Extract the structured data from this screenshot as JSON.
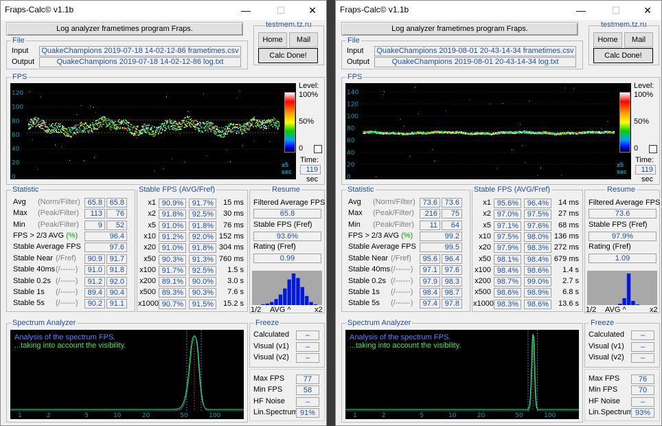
{
  "windows": [
    {
      "title": "Fraps-Calc© v1.1b",
      "header_text": "Log analyzer frametimes program Fraps.",
      "site_link": "testmem.tz.ru",
      "home_label": "Home",
      "mail_label": "Mail",
      "calc_label": "Calc Done!",
      "file_group": "File",
      "input_label": "Input",
      "output_label": "Output",
      "input_value": "QuakeChampions 2019-07-18 14-02-12-86 frametimes.csv",
      "output_value": "QuakeChampions 2019-07-18 14-02-12-86 log.txt",
      "fps_group": "FPS",
      "fps_ticks": [
        "120",
        "100",
        "80",
        "60",
        "40",
        "20",
        "0"
      ],
      "level_label": "Level:",
      "level_ticks": [
        "100%",
        "50%",
        "0"
      ],
      "time_label": "Time:",
      "time_value": "119",
      "time_unit": "sec",
      "x5_label": "x5",
      "sec_label": "sec",
      "statistic_group": "Statistic",
      "stable_group": "Stable FPS (AVG/Fref)",
      "resume_group": "Resume",
      "stats": [
        {
          "label": "Avg",
          "hint": "(Norm/Filter)",
          "v1": "65.8",
          "v2": "65.8"
        },
        {
          "label": "Max",
          "hint": "(Peak/Filter)",
          "v1": "113",
          "v2": "76"
        },
        {
          "label": "Min",
          "hint": "(Peak/Filter)",
          "v1": "9",
          "v2": "52"
        }
      ],
      "fps_23_label": "FPS > 2/3 AVG",
      "fps_23_pct": "(%)",
      "fps_23_value": "96.4",
      "stable_avg_label": "Stable Average FPS",
      "stable_avg_value": "97.6",
      "stable_rows": [
        {
          "label": "Stable Near",
          "hint": "(/Fref)",
          "v1": "90.9",
          "v2": "91.7"
        },
        {
          "label": "Stable 40ms",
          "hint": "(/------)",
          "v1": "91.0",
          "v2": "91.8"
        },
        {
          "label": "Stable 0.2s",
          "hint": "(/------)",
          "v1": "91.2",
          "v2": "92.0"
        },
        {
          "label": "Stable 1s",
          "hint": "(/------)",
          "v1": "89.4",
          "v2": "90.4"
        },
        {
          "label": "Stable 5s",
          "hint": "(/------)",
          "v1": "90.2",
          "v2": "91.1"
        }
      ],
      "stable_fps": [
        {
          "mult": "x1",
          "avg": "90.9%",
          "fref": "91.7%",
          "time": "15 ms"
        },
        {
          "mult": "x2",
          "avg": "91.8%",
          "fref": "92.5%",
          "time": "30 ms"
        },
        {
          "mult": "x5",
          "avg": "91.0%",
          "fref": "91.8%",
          "time": "76 ms"
        },
        {
          "mult": "x10",
          "avg": "91.2%",
          "fref": "92.0%",
          "time": "152 ms"
        },
        {
          "mult": "x20",
          "avg": "91.0%",
          "fref": "91.8%",
          "time": "304 ms"
        },
        {
          "mult": "x50",
          "avg": "90.3%",
          "fref": "91.3%",
          "time": "760 ms"
        },
        {
          "mult": "x100",
          "avg": "91.7%",
          "fref": "92.5%",
          "time": "1.5 s"
        },
        {
          "mult": "x200",
          "avg": "89.1%",
          "fref": "90.0%",
          "time": "3.0 s"
        },
        {
          "mult": "x500",
          "avg": "89.3%",
          "fref": "90.3%",
          "time": "7.6 s"
        },
        {
          "mult": "x1000",
          "avg": "90.7%",
          "fref": "91.5%",
          "time": "15.2 s"
        }
      ],
      "resume": {
        "filtered_label": "Filtered Average FPS",
        "filtered_value": "65.8",
        "stable_label": "Stable FPS (Fref)",
        "stable_value": "93.6%",
        "rating_label": "Rating (Fref)",
        "rating_value": "0.99"
      },
      "hist_labels": {
        "left": "1/2",
        "mid": "AVG ^",
        "right": "x2"
      },
      "hist_values": [
        0,
        0,
        1,
        2,
        4,
        8,
        14,
        22,
        34,
        42,
        36,
        24,
        12,
        4,
        1,
        0
      ],
      "spectrum_group": "Spectrum Analyzer",
      "spectrum_text1": "Analysis of the spectrum FPS.",
      "spectrum_text2": "...taking into account the visibility.",
      "spectrum_ticks": [
        "1",
        "2",
        "5",
        "10",
        "20",
        "50",
        "100"
      ],
      "freeze_group": "Freeze",
      "freeze": [
        {
          "label": "Calculated",
          "value": "–"
        },
        {
          "label": "Visual  (v1)",
          "value": "–"
        },
        {
          "label": "Visual  (v2)",
          "value": "–"
        }
      ],
      "spec_stats": [
        {
          "label": "Max FPS",
          "value": "77"
        },
        {
          "label": "Min  FPS",
          "value": "58"
        },
        {
          "label": "HF Noise",
          "value": "–"
        },
        {
          "label": "Lin.Spectrum",
          "value": "91%"
        }
      ],
      "fps_center": 72,
      "fps_spread": 9,
      "spec_peaks": [
        62,
        72
      ]
    },
    {
      "title": "Fraps-Calc© v1.1b",
      "header_text": "Log analyzer frametimes program Fraps.",
      "site_link": "testmem.tz.ru",
      "home_label": "Home",
      "mail_label": "Mail",
      "calc_label": "Calc Done!",
      "file_group": "File",
      "input_label": "Input",
      "output_label": "Output",
      "input_value": "QuakeChampions 2019-08-01 20-43-14-34 frametimes.csv",
      "output_value": "QuakeChampions 2019-08-01 20-43-14-34 log.txt",
      "fps_group": "FPS",
      "fps_ticks": [
        "140",
        "120",
        "100",
        "80",
        "60",
        "40",
        "20",
        "0"
      ],
      "level_label": "Level:",
      "level_ticks": [
        "100%",
        "50%",
        "0"
      ],
      "time_label": "Time:",
      "time_value": "119",
      "time_unit": "sec",
      "x5_label": "x5",
      "sec_label": "sec",
      "statistic_group": "Statistic",
      "stable_group": "Stable FPS (AVG/Fref)",
      "resume_group": "Resume",
      "stats": [
        {
          "label": "Avg",
          "hint": "(Norm/Filter)",
          "v1": "73.6",
          "v2": "73.6"
        },
        {
          "label": "Max",
          "hint": "(Peak/Filter)",
          "v1": "216",
          "v2": "75"
        },
        {
          "label": "Min",
          "hint": "(Peak/Filter)",
          "v1": "11",
          "v2": "64"
        }
      ],
      "fps_23_label": "FPS > 2/3 AVG",
      "fps_23_pct": "(%)",
      "fps_23_value": "99.2",
      "stable_avg_label": "Stable Average FPS",
      "stable_avg_value": "99.5",
      "stable_rows": [
        {
          "label": "Stable Near",
          "hint": "(/Fref)",
          "v1": "95.6",
          "v2": "96.4"
        },
        {
          "label": "Stable 40ms",
          "hint": "(/------)",
          "v1": "97.1",
          "v2": "97.6"
        },
        {
          "label": "Stable 0.2s",
          "hint": "(/------)",
          "v1": "97.9",
          "v2": "98.3"
        },
        {
          "label": "Stable 1s",
          "hint": "(/------)",
          "v1": "98.4",
          "v2": "98.7"
        },
        {
          "label": "Stable 5s",
          "hint": "(/------)",
          "v1": "97.4",
          "v2": "97.8"
        }
      ],
      "stable_fps": [
        {
          "mult": "x1",
          "avg": "95.6%",
          "fref": "96.4%",
          "time": "14 ms"
        },
        {
          "mult": "x2",
          "avg": "97.0%",
          "fref": "97.5%",
          "time": "27 ms"
        },
        {
          "mult": "x5",
          "avg": "97.1%",
          "fref": "97.6%",
          "time": "68 ms"
        },
        {
          "mult": "x10",
          "avg": "97.5%",
          "fref": "98.0%",
          "time": "136 ms"
        },
        {
          "mult": "x20",
          "avg": "97.9%",
          "fref": "98.3%",
          "time": "272 ms"
        },
        {
          "mult": "x50",
          "avg": "98.1%",
          "fref": "98.4%",
          "time": "679 ms"
        },
        {
          "mult": "x100",
          "avg": "98.4%",
          "fref": "98.6%",
          "time": "1.4 s"
        },
        {
          "mult": "x200",
          "avg": "98.7%",
          "fref": "99.0%",
          "time": "2.7 s"
        },
        {
          "mult": "x500",
          "avg": "98.6%",
          "fref": "98.9%",
          "time": "6.8 s"
        },
        {
          "mult": "x1000",
          "avg": "98.3%",
          "fref": "98.6%",
          "time": "13.6 s"
        }
      ],
      "resume": {
        "filtered_label": "Filtered Average FPS",
        "filtered_value": "73.6",
        "stable_label": "Stable FPS (Fref)",
        "stable_value": "97.9%",
        "rating_label": "Rating (Fref)",
        "rating_value": "1.09"
      },
      "hist_labels": {
        "left": "1/2",
        "mid": "AVG ^",
        "right": "x2"
      },
      "hist_values": [
        0,
        0,
        0,
        0,
        0,
        0,
        0,
        2,
        10,
        46,
        6,
        1,
        0,
        0,
        0,
        0
      ],
      "spectrum_group": "Spectrum Analyzer",
      "spectrum_text1": "Analysis of the spectrum FPS.",
      "spectrum_text2": "...taking into account the visibility.",
      "spectrum_ticks": [
        "1",
        "2",
        "5",
        "10",
        "20",
        "50",
        "100"
      ],
      "freeze_group": "Freeze",
      "freeze": [
        {
          "label": "Calculated",
          "value": "–"
        },
        {
          "label": "Visual  (v1)",
          "value": "–"
        },
        {
          "label": "Visual  (v2)",
          "value": "–"
        }
      ],
      "spec_stats": [
        {
          "label": "Max FPS",
          "value": "76"
        },
        {
          "label": "Min  FPS",
          "value": "70"
        },
        {
          "label": "HF Noise",
          "value": "–"
        },
        {
          "label": "Lin.Spectrum",
          "value": "93%"
        }
      ],
      "fps_center": 73,
      "fps_spread": 2,
      "spec_peaks": [
        72,
        74
      ]
    }
  ]
}
